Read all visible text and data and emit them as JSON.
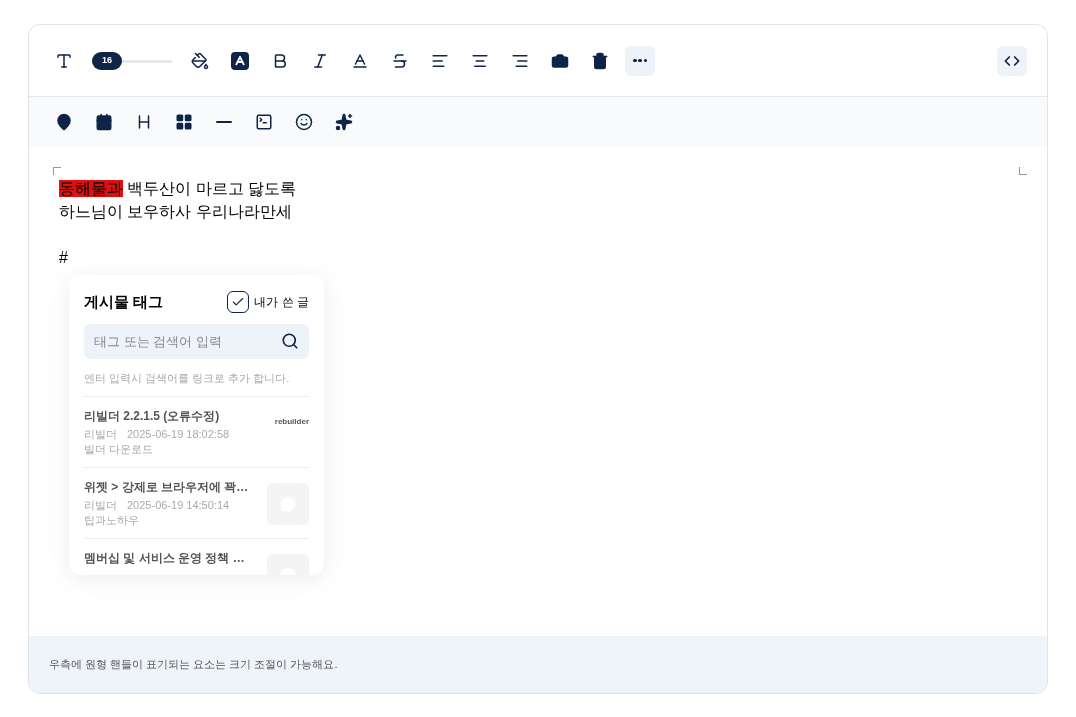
{
  "toolbar": {
    "font_size": {
      "value": "16",
      "level": 0
    },
    "buttons": [
      {
        "selected": false
      },
      {
        "selected": false
      },
      {
        "selected": false
      },
      {
        "selected": false
      },
      {
        "selected": false
      },
      {
        "selected": false
      },
      {
        "selected": false
      },
      {
        "selected": false
      },
      {
        "selected": false
      },
      {
        "selected": false
      },
      {
        "selected": false
      },
      {
        "selected": false
      },
      {
        "selected": true
      }
    ],
    "code_button": {
      "selected": true
    }
  },
  "editor": {
    "lines": [
      {
        "kind": "text",
        "segments": [
          {
            "text": "동해물과",
            "highlighted": true
          },
          {
            "text": " 백두산이 마르고 닳도록",
            "highlighted": false
          }
        ]
      },
      {
        "kind": "text",
        "segments": [
          {
            "text": "하느님이 보우하사 우리나라만세",
            "highlighted": false
          }
        ]
      },
      {
        "kind": "blank"
      },
      {
        "kind": "text",
        "segments": [
          {
            "text": "#",
            "highlighted": false
          }
        ]
      }
    ]
  },
  "tag_popup": {
    "title": "게시물 태그",
    "my_posts": {
      "label": "내가 쓴 글",
      "checked": true
    },
    "search": {
      "placeholder": "태그 또는 검색어 입력"
    },
    "hint": "엔터 입력시 검색어를 링크로 추가 합니다.",
    "posts": [
      {
        "title": "리빌더 2.2.1.5 (오류수정)",
        "author": "리빌더",
        "date": "2025-06-19 18:02:58",
        "category": "빌더 다운로드",
        "thumbnail": {
          "kind": "logo",
          "text": "rebuilder"
        }
      },
      {
        "title": "위젯 > 강제로 브라우저에 꽉…",
        "author": "리빌더",
        "date": "2025-06-19 14:50:14",
        "category": "팁과노하우",
        "thumbnail": {
          "kind": "placeholder"
        }
      },
      {
        "title": "멤버십 및 서비스 운영 정책 …",
        "thumbnail": {
          "kind": "placeholder"
        }
      }
    ]
  },
  "footer": {
    "note": "우측에 원형 핸들이 표기되는 요소는 크기 조절이 가능해요."
  }
}
